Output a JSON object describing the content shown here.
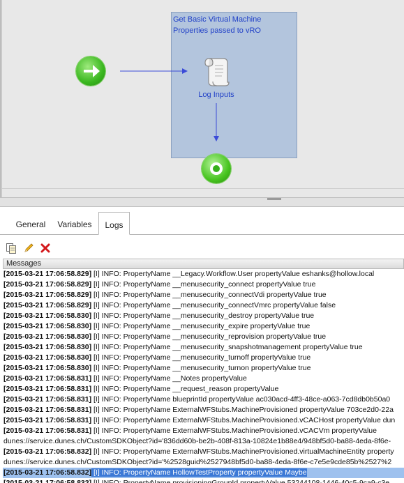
{
  "workflow": {
    "box_title": "Get Basic Virtual Machine Properties passed to vRO",
    "task_label": "Log Inputs",
    "icons": {
      "start": "start-arrow-icon",
      "end": "end-node-icon",
      "task": "scroll-script-icon"
    }
  },
  "tabs": [
    {
      "label": "General",
      "active": false
    },
    {
      "label": "Variables",
      "active": false
    },
    {
      "label": "Logs",
      "active": true
    }
  ],
  "toolbar": {
    "icons": [
      "copy-icon",
      "edit-pencil-icon",
      "delete-x-icon"
    ]
  },
  "log_table": {
    "header": "Messages",
    "rows": [
      {
        "ts": "[2015-03-21 17:06:58.829]",
        "msg": " [I] INFO:  PropertyName __Legacy.Workflow.User propertyValue eshanks@hollow.local"
      },
      {
        "ts": "[2015-03-21 17:06:58.829]",
        "msg": " [I] INFO:  PropertyName __menusecurity_connect propertyValue true"
      },
      {
        "ts": "[2015-03-21 17:06:58.829]",
        "msg": " [I] INFO:  PropertyName __menusecurity_connectVdi propertyValue true"
      },
      {
        "ts": "[2015-03-21 17:06:58.829]",
        "msg": " [I] INFO:  PropertyName __menusecurity_connectVmrc propertyValue false"
      },
      {
        "ts": "[2015-03-21 17:06:58.830]",
        "msg": " [I] INFO:  PropertyName __menusecurity_destroy propertyValue true"
      },
      {
        "ts": "[2015-03-21 17:06:58.830]",
        "msg": " [I] INFO:  PropertyName __menusecurity_expire propertyValue true"
      },
      {
        "ts": "[2015-03-21 17:06:58.830]",
        "msg": " [I] INFO:  PropertyName __menusecurity_reprovision propertyValue true"
      },
      {
        "ts": "[2015-03-21 17:06:58.830]",
        "msg": " [I] INFO:  PropertyName __menusecurity_snapshotmanagement propertyValue true"
      },
      {
        "ts": "[2015-03-21 17:06:58.830]",
        "msg": " [I] INFO:  PropertyName __menusecurity_turnoff propertyValue true"
      },
      {
        "ts": "[2015-03-21 17:06:58.830]",
        "msg": " [I] INFO:  PropertyName __menusecurity_turnon propertyValue true"
      },
      {
        "ts": "[2015-03-21 17:06:58.831]",
        "msg": " [I] INFO:  PropertyName __Notes propertyValue"
      },
      {
        "ts": "[2015-03-21 17:06:58.831]",
        "msg": " [I] INFO:  PropertyName __request_reason propertyValue"
      },
      {
        "ts": "[2015-03-21 17:06:58.831]",
        "msg": " [I] INFO:  PropertyName blueprintId propertyValue ac030acd-4ff3-48ce-a063-7cd8db0b50a0"
      },
      {
        "ts": "[2015-03-21 17:06:58.831]",
        "msg": " [I] INFO:  PropertyName ExternalWFStubs.MachineProvisioned propertyValue 703ce2d0-22a"
      },
      {
        "ts": "[2015-03-21 17:06:58.831]",
        "msg": " [I] INFO:  PropertyName ExternalWFStubs.MachineProvisioned.vCACHost propertyValue dun"
      },
      {
        "ts": "[2015-03-21 17:06:58.831]",
        "msg": " [I] INFO:  PropertyName ExternalWFStubs.MachineProvisioned.vCACVm propertyValue"
      },
      {
        "ts": "",
        "msg": "dunes://service.dunes.ch/CustomSDKObject?id='836dd60b-be2b-408f-813a-10824e1b88e4/948bf5d0-ba88-4eda-8f6e-"
      },
      {
        "ts": "[2015-03-21 17:06:58.832]",
        "msg": " [I] INFO:  PropertyName ExternalWFStubs.MachineProvisioned.virtualMachineEntity property"
      },
      {
        "ts": "",
        "msg": "dunes://service.dunes.ch/CustomSDKObject?id='%2528guid%2527948bf5d0-ba88-4eda-8f6e-c7e5e9cde85b%2527%2"
      },
      {
        "ts": "[2015-03-21 17:06:58.832]",
        "msg": " [I] INFO:  PropertyName HollowTestProperty propertyValue Maybe",
        "selected": true
      },
      {
        "ts": "[2015-03-21 17:06:58.832]",
        "msg": " [I] INFO:  PropertyName provisioningGroupId propertyValue 53244108-1446-40c5-9ca9-c3e"
      }
    ]
  },
  "colors": {
    "selection": "#3c79d6",
    "workflow_box": "#b3c5dd",
    "link_text": "#1f3fc7"
  }
}
